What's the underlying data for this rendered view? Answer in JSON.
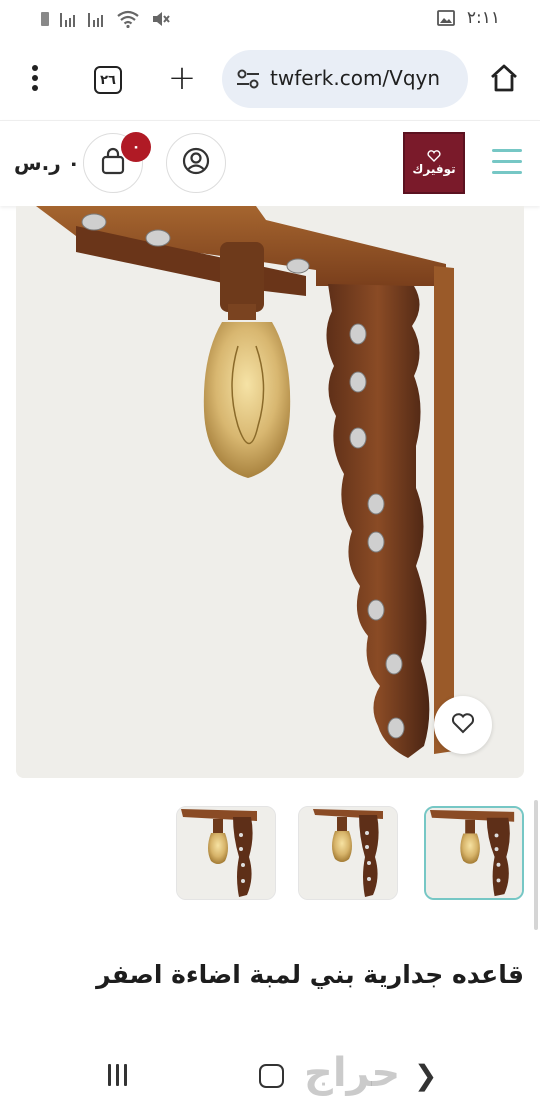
{
  "status_bar": {
    "time": "٢:١١",
    "icons": [
      "sim-icon",
      "signal-icon",
      "signal-icon",
      "wifi-icon",
      "mute-icon",
      "image-notification-icon"
    ]
  },
  "browser": {
    "tab_count": "٢٦",
    "url": "twferk.com/Vqyn",
    "icons": [
      "menu-dots-icon",
      "tab-switcher-icon",
      "new-tab-icon",
      "site-settings-icon",
      "home-icon"
    ]
  },
  "header": {
    "price": "٠ ر.س",
    "cart_count": "٠",
    "logo_text": "توفيرك",
    "icons": [
      "cart-icon",
      "account-icon",
      "hamburger-icon"
    ],
    "accent_color": "#76c7c5",
    "badge_color": "#b01a25"
  },
  "product": {
    "title": "قاعده جدارية بني لمبة اضاءة اصفر",
    "thumbnails": [
      {
        "label": "product-image-1",
        "active": true
      },
      {
        "label": "product-image-2",
        "active": false
      },
      {
        "label": "product-image-3",
        "active": false
      }
    ]
  },
  "nav": {
    "watermark": "حراج",
    "icons": [
      "recent-apps-icon",
      "home-button-icon",
      "back-icon"
    ]
  }
}
